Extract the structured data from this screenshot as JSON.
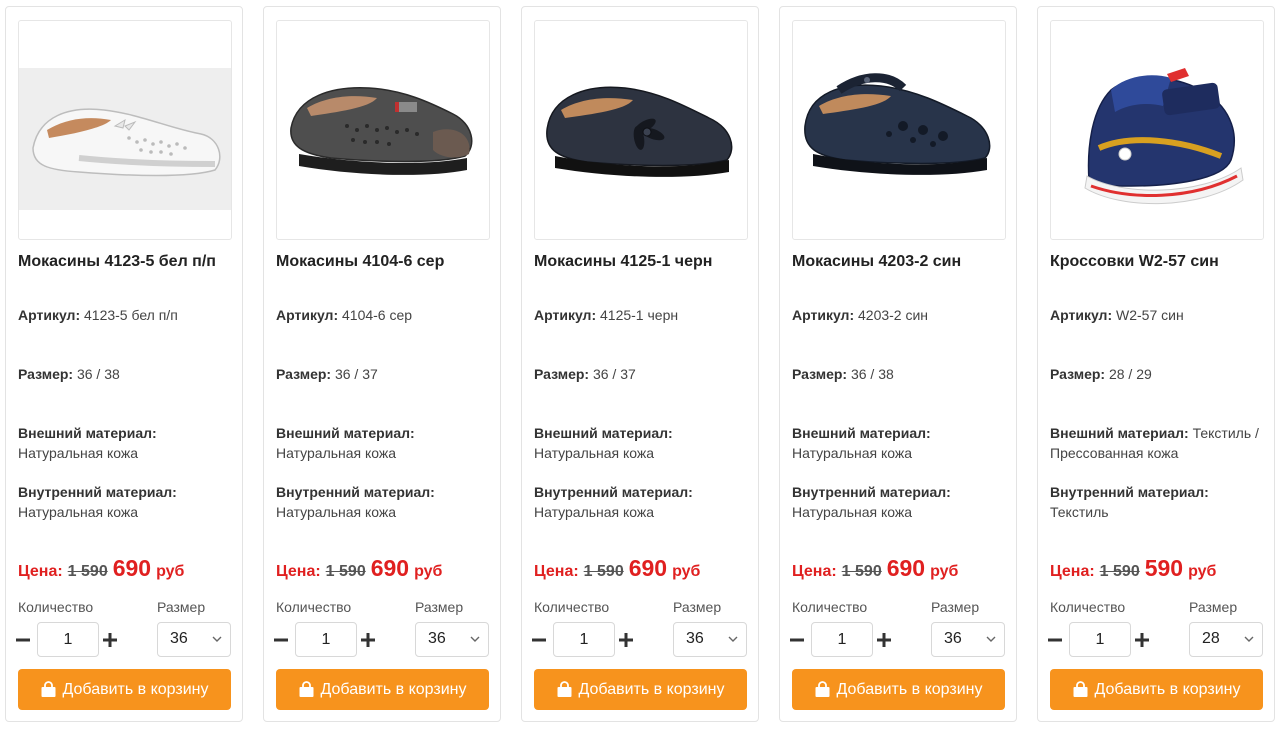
{
  "labels": {
    "article": "Артикул:",
    "size": "Размер:",
    "outer": "Внешний материал:",
    "inner": "Внутренний материал:",
    "price": "Цена:",
    "quantity": "Количество",
    "size_select": "Размер",
    "add_to_cart": "Добавить в корзину"
  },
  "colors": {
    "accent": "#f7931d",
    "price_red": "#e02020",
    "border": "#e3e3e3"
  },
  "products": [
    {
      "title": "Мокасины 4123-5 бел п/п",
      "article": "4123-5 бел п/п",
      "size_range": "36 / 38",
      "outer_material": "Натуральная кожа",
      "inner_material": "Натуральная кожа",
      "old_price": "1 590",
      "new_price": "690",
      "currency": "руб",
      "quantity": "1",
      "size_selected": "36",
      "image": "white-perforated-moccasin-with-bow"
    },
    {
      "title": "Мокасины 4104-6 сер",
      "article": "4104-6 сер",
      "size_range": "36 / 37",
      "outer_material": "Натуральная кожа",
      "inner_material": "Натуральная кожа",
      "old_price": "1 590",
      "new_price": "690",
      "currency": "руб",
      "quantity": "1",
      "size_selected": "36",
      "image": "grey-perforated-slip-on-moccasin"
    },
    {
      "title": "Мокасины 4125-1 черн",
      "article": "4125-1 черн",
      "size_range": "36 / 37",
      "outer_material": "Натуральная кожа",
      "inner_material": "Натуральная кожа",
      "old_price": "1 590",
      "new_price": "690",
      "currency": "руб",
      "quantity": "1",
      "size_selected": "36",
      "image": "black-moccasin-with-flower"
    },
    {
      "title": "Мокасины 4203-2 син",
      "article": "4203-2 син",
      "size_range": "36 / 38",
      "outer_material": "Натуральная кожа",
      "inner_material": "Натуральная кожа",
      "old_price": "1 590",
      "new_price": "690",
      "currency": "руб",
      "quantity": "1",
      "size_selected": "36",
      "image": "navy-mary-jane-with-strap"
    },
    {
      "title": "Кроссовки W2-57 син",
      "article": "W2-57 син",
      "size_range": "28 / 29",
      "outer_material": "Текстиль / Прессованная кожа",
      "inner_material": "Текстиль",
      "old_price": "1 590",
      "new_price": "590",
      "currency": "руб",
      "quantity": "1",
      "size_selected": "28",
      "image": "blue-kids-sneaker"
    }
  ]
}
